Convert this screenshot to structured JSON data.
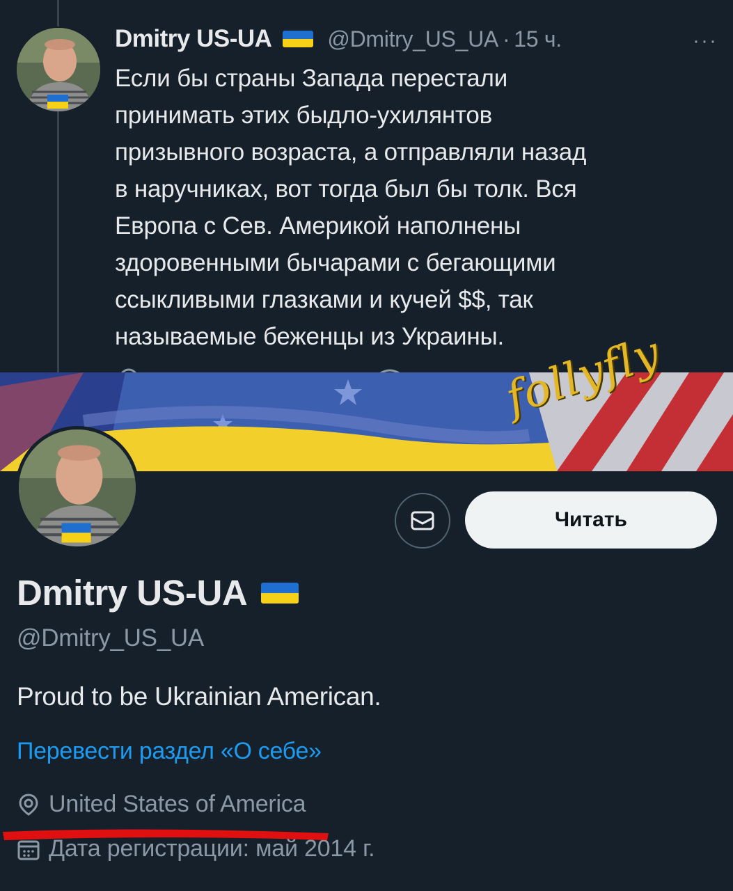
{
  "tweet": {
    "display_name": "Dmitry US-UA",
    "handle": "@Dmitry_US_UA",
    "separator": "·",
    "time": "15 ч.",
    "more": "···",
    "text": "Если бы страны Запада перестали\nпринимать этих быдло-ухилянтов\nпризывного возраста, а отправляли назад\nв наручниках, вот тогда был бы толк. Вся\nЕвропа с Сев. Америкой наполнены\nздоровенными бычарами с бегающими\nссыкливыми глазками и кучей $$, так\nназываемые беженцы из Украины."
  },
  "watermark": "follyfly",
  "profile": {
    "display_name": "Dmitry US-UA",
    "handle": "@Dmitry_US_UA",
    "follow_label": "Читать",
    "bio": "Proud to be Ukrainian American.",
    "translate_link": "Перевести раздел «О себе»",
    "location": "United States of America",
    "joined": "Дата регистрации: май 2014 г."
  },
  "colors": {
    "background": "#15202b",
    "text": "#e7e9ea",
    "muted": "#8b98a5",
    "link": "#1d9bf0",
    "flag_blue": "#1f6fd0",
    "flag_yellow": "#f7d117",
    "annotation_red": "#e01010"
  }
}
